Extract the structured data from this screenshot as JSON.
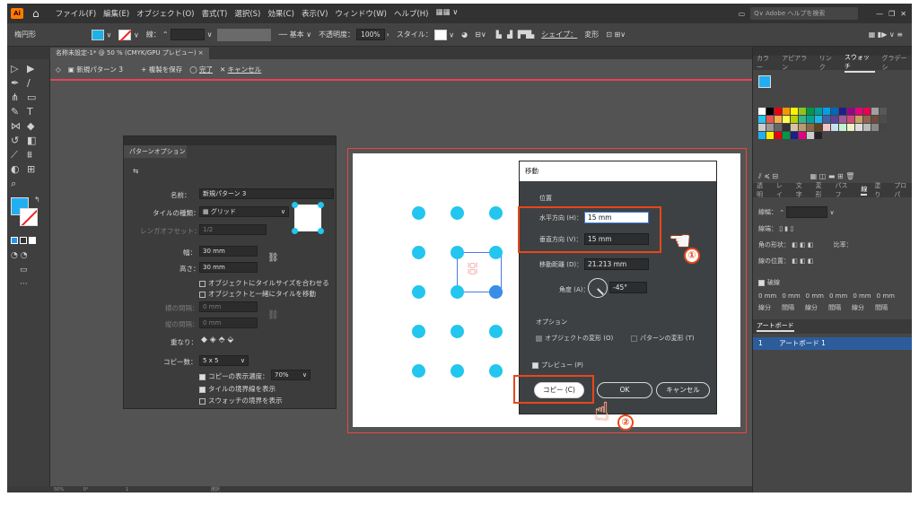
{
  "menubar": {
    "logo": "Ai",
    "menus": [
      "ファイル(F)",
      "編集(E)",
      "オブジェクト(O)",
      "書式(T)",
      "選択(S)",
      "効果(C)",
      "表示(V)",
      "ウィンドウ(W)",
      "ヘルプ(H)"
    ],
    "search_placeholder": "Q∨ Adobe ヘルプを検索"
  },
  "control": {
    "shape_label": "楕円形",
    "stroke_label": "線：",
    "stroke_style": "基本",
    "opacity_label": "不透明度：",
    "opacity_value": "100%",
    "style_label": "スタイル：",
    "shape_link": "シェイプ：",
    "transform": "変形"
  },
  "document_tab": "名称未設定-1* @ 50 % (CMYK/GPU プレビュー)",
  "isolation": {
    "path": "新規パターン 3",
    "save_copy": "+ 複製を保存",
    "done": "完了",
    "cancel": "キャンセル"
  },
  "pattern_panel": {
    "title": "パターンオプション",
    "name_label": "名前：",
    "name_value": "新規パターン 3",
    "tile_type_label": "タイルの種類：",
    "tile_type_value": "▦ グリッド",
    "brick_offset_label": "レンガオフセット：",
    "brick_offset_value": "1/2",
    "width_label": "幅：",
    "width_value": "30 mm",
    "height_label": "高さ：",
    "height_value": "30 mm",
    "fit_tile": "オブジェクトにタイルサイズを合わせる",
    "move_tile": "オブジェクトと一緒にタイルを移動",
    "h_spacing_label": "横の間隔：",
    "h_spacing_value": "0 mm",
    "v_spacing_label": "縦の間隔：",
    "v_spacing_value": "0 mm",
    "overlap_label": "重なり：",
    "copies_label": "コピー数：",
    "copies_value": "5 x 5",
    "dim_copies": "コピーの表示濃度：",
    "dim_value": "70%",
    "show_tile_edge": "タイルの境界線を表示",
    "show_swatch_bounds": "スウォッチの境界を表示"
  },
  "move_dialog": {
    "title": "移動",
    "position_section": "位置",
    "horizontal_label": "水平方向 (H)：",
    "horizontal_value": "15 mm",
    "vertical_label": "垂直方向 (V)：",
    "vertical_value": "15 mm",
    "distance_label": "移動距離 (D)：",
    "distance_value": "21.213 mm",
    "angle_label": "角度 (A)：",
    "angle_value": "-45°",
    "options_section": "オプション",
    "opt_transform_objects": "オブジェクトの変形 (O)",
    "opt_transform_patterns": "パターンの変形 (T)",
    "preview_label": "プレビュー (P)",
    "copy_button": "コピー (C)",
    "ok_button": "OK",
    "cancel_button": "キャンセル"
  },
  "callouts": {
    "one": "①",
    "two": "②"
  },
  "right_panel": {
    "tabs": [
      "カラー",
      "アピアラン",
      "リンク",
      "スウォッチ",
      "グラデーシ"
    ],
    "active_tab": "スウォッチ",
    "lower_tabs": [
      "透明",
      "レイ",
      "文字",
      "変形",
      "パスフ",
      "線",
      "塗り",
      "プロパ"
    ],
    "weight_label": "線幅：",
    "corner_label": "角の形状：",
    "limit_label": "比率：",
    "align_label": "線の位置：",
    "dashed_label": "破線",
    "dash_items": [
      "線分",
      "間隔",
      "線分",
      "間隔",
      "線分",
      "間隔"
    ],
    "dash_values": [
      "0 mm",
      "0 mm",
      "0 mm",
      "0 mm",
      "0 mm",
      "0 mm"
    ],
    "artboards_title": "アートボード",
    "artboard_index": "1",
    "artboard_name": "アートボード 1"
  },
  "status": {
    "zoom": "50%",
    "rotation": "0°",
    "page": "1",
    "mode": "選択"
  },
  "colors": {
    "accent_dot": "#22c6ee",
    "highlight": "#e8471b",
    "isolation_border": "#e8425a"
  }
}
